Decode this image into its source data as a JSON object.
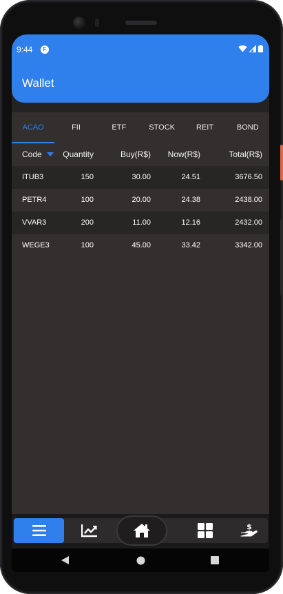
{
  "status_bar": {
    "time": "9:44",
    "app_badge": "F"
  },
  "app_bar": {
    "title": "Wallet"
  },
  "tabs": [
    {
      "label": "ACAO",
      "active": true
    },
    {
      "label": "FII",
      "active": false
    },
    {
      "label": "ETF",
      "active": false
    },
    {
      "label": "STOCK",
      "active": false
    },
    {
      "label": "REIT",
      "active": false
    },
    {
      "label": "BOND",
      "active": false
    }
  ],
  "table": {
    "columns": [
      "Code",
      "Quantity",
      "Buy(R$)",
      "Now(R$)",
      "Total(R$)"
    ],
    "sort_icon": "caret-down-icon",
    "rows": [
      {
        "code": "ITUB3",
        "quantity": "150",
        "buy": "30.00",
        "now": "24.51",
        "total": "3676.50"
      },
      {
        "code": "PETR4",
        "quantity": "100",
        "buy": "20.00",
        "now": "24.38",
        "total": "2438.00"
      },
      {
        "code": "VVAR3",
        "quantity": "200",
        "buy": "11.00",
        "now": "12.16",
        "total": "2432.00"
      },
      {
        "code": "WEGE3",
        "quantity": "100",
        "buy": "45.00",
        "now": "33.42",
        "total": "3342.00"
      }
    ]
  },
  "bottom_nav": [
    {
      "icon": "list-icon",
      "active": true
    },
    {
      "icon": "chart-line-icon",
      "active": false
    },
    {
      "icon": "home-icon",
      "active": false
    },
    {
      "icon": "grid-icon",
      "active": false
    },
    {
      "icon": "hand-dollar-icon",
      "active": false
    }
  ],
  "system_nav": [
    "back-icon",
    "home-circle-icon",
    "recents-icon"
  ],
  "colors": {
    "accent": "#2f80ed",
    "background": "#332f2f",
    "row_alt": "#282525"
  }
}
